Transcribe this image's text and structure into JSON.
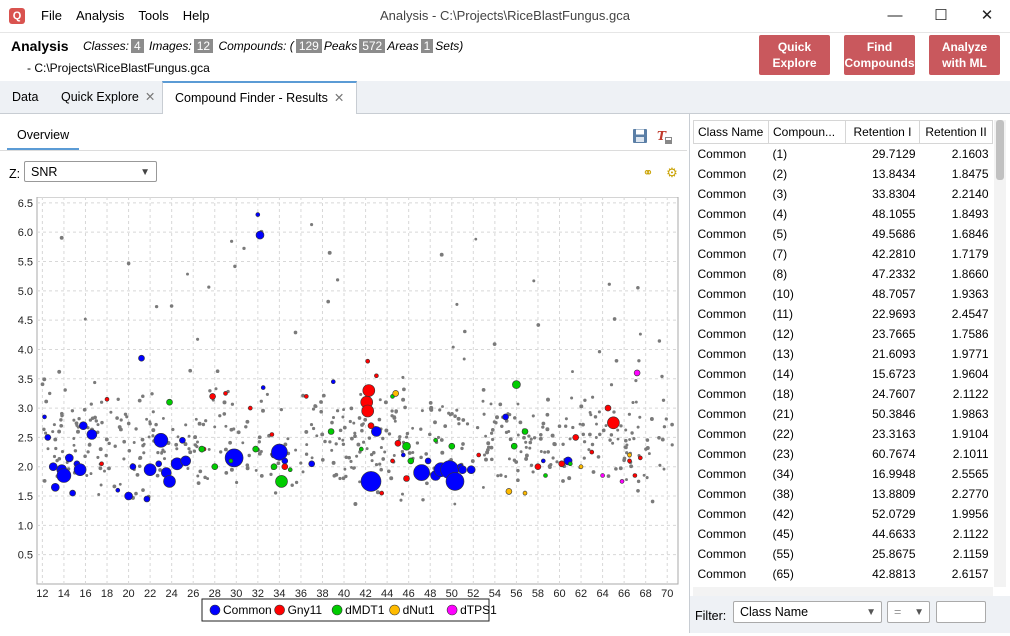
{
  "window": {
    "title": "Analysis - C:\\Projects\\RiceBlastFungus.gca",
    "app_icon": "magnifier-icon"
  },
  "menu": [
    "File",
    "Analysis",
    "Tools",
    "Help"
  ],
  "header": {
    "title": "Analysis",
    "classes_label": "Classes:",
    "classes": "4",
    "images_label": "Images:",
    "images": "12",
    "compounds_label": "Compounds: (",
    "compounds": "129",
    "peaks_label": "Peaks",
    "peaks": "572",
    "areas_label": "Areas",
    "areas": "1",
    "sets_label": "Sets)",
    "path": "- C:\\Projects\\RiceBlastFungus.gca",
    "buttons": {
      "quick_explore": "Quick Explore",
      "find_compounds": "Find Compounds",
      "analyze_ml": "Analyze with ML"
    }
  },
  "tabs": [
    {
      "label": "Data"
    },
    {
      "label": "Quick Explore",
      "closable": true
    },
    {
      "label": "Compound Finder - Results",
      "closable": true,
      "active": true
    }
  ],
  "subtab": "Overview",
  "z_selector": {
    "label": "Z:",
    "value": "SNR"
  },
  "chart_data": {
    "type": "scatter",
    "xlim": [
      11.5,
      71
    ],
    "ylim": [
      0,
      6.6
    ],
    "x_ticks": [
      12,
      14,
      16,
      18,
      20,
      22,
      24,
      26,
      28,
      30,
      32,
      34,
      36,
      38,
      40,
      42,
      44,
      46,
      48,
      50,
      52,
      54,
      56,
      58,
      60,
      62,
      64,
      66,
      68,
      70
    ],
    "y_ticks": [
      0.5,
      1.0,
      1.5,
      2.0,
      2.5,
      3.0,
      3.5,
      4.0,
      4.5,
      5.0,
      5.5,
      6.0,
      6.5
    ],
    "grid": true,
    "legend_position": "bottom",
    "legend": [
      {
        "name": "Common",
        "color": "#0000ff"
      },
      {
        "name": "Gny11",
        "color": "#ff0000"
      },
      {
        "name": "dMDT1",
        "color": "#00cc00"
      },
      {
        "name": "dNut1",
        "color": "#ffbb00"
      },
      {
        "name": "dTPS1",
        "color": "#ff00ff"
      }
    ],
    "series": [
      {
        "name": "Common",
        "color": "#0000ff",
        "points": [
          [
            12.2,
            2.85,
            2
          ],
          [
            12.5,
            2.5,
            3
          ],
          [
            13.0,
            2.0,
            4
          ],
          [
            13.2,
            1.65,
            4
          ],
          [
            13.8,
            1.95,
            5
          ],
          [
            14.0,
            1.85,
            7
          ],
          [
            14.5,
            2.15,
            4
          ],
          [
            14.8,
            1.55,
            3
          ],
          [
            15.2,
            2.05,
            3
          ],
          [
            15.5,
            1.95,
            6
          ],
          [
            15.8,
            2.7,
            4
          ],
          [
            16.6,
            2.55,
            5
          ],
          [
            19.0,
            1.6,
            2
          ],
          [
            20.0,
            1.5,
            4
          ],
          [
            20.4,
            2.0,
            3
          ],
          [
            21.2,
            3.85,
            3
          ],
          [
            21.7,
            1.45,
            3
          ],
          [
            22.0,
            1.95,
            6
          ],
          [
            22.8,
            2.05,
            3
          ],
          [
            23.0,
            2.45,
            7
          ],
          [
            23.5,
            1.9,
            5
          ],
          [
            23.8,
            1.75,
            6
          ],
          [
            24.5,
            2.05,
            6
          ],
          [
            25.0,
            2.45,
            3
          ],
          [
            25.3,
            2.1,
            5
          ],
          [
            29.8,
            2.15,
            9
          ],
          [
            32.0,
            6.3,
            2
          ],
          [
            32.2,
            5.95,
            4
          ],
          [
            32.5,
            3.35,
            2
          ],
          [
            33.5,
            2.2,
            3
          ],
          [
            34.0,
            2.25,
            8
          ],
          [
            34.5,
            2.1,
            3
          ],
          [
            37.0,
            2.05,
            3
          ],
          [
            39.0,
            3.45,
            2
          ],
          [
            42.5,
            1.75,
            10
          ],
          [
            43.0,
            2.6,
            5
          ],
          [
            45.5,
            2.2,
            2
          ],
          [
            47.2,
            1.9,
            8
          ],
          [
            47.8,
            2.1,
            3
          ],
          [
            48.5,
            1.85,
            5
          ],
          [
            49.0,
            1.95,
            7
          ],
          [
            49.8,
            1.95,
            9
          ],
          [
            50.3,
            1.75,
            9
          ],
          [
            50.8,
            2.0,
            3
          ],
          [
            51.0,
            1.95,
            4
          ],
          [
            51.8,
            1.95,
            4
          ],
          [
            55.0,
            2.85,
            3
          ],
          [
            58.5,
            2.1,
            2
          ],
          [
            60.8,
            2.1,
            4
          ]
        ]
      },
      {
        "name": "Gny11",
        "color": "#ff0000",
        "points": [
          [
            17.5,
            2.05,
            2
          ],
          [
            18.0,
            3.15,
            2
          ],
          [
            27.0,
            2.3,
            2
          ],
          [
            27.8,
            3.2,
            3
          ],
          [
            29.0,
            3.25,
            2
          ],
          [
            31.3,
            3.0,
            2
          ],
          [
            33.3,
            2.55,
            2
          ],
          [
            34.5,
            2.0,
            3
          ],
          [
            36.5,
            3.2,
            2
          ],
          [
            42.2,
            3.8,
            2
          ],
          [
            42.3,
            3.3,
            6
          ],
          [
            42.1,
            3.1,
            6
          ],
          [
            42.2,
            2.95,
            6
          ],
          [
            42.5,
            2.7,
            3
          ],
          [
            43.0,
            3.55,
            2
          ],
          [
            43.5,
            1.55,
            2
          ],
          [
            44.5,
            2.1,
            2
          ],
          [
            45.0,
            2.4,
            3
          ],
          [
            45.8,
            1.8,
            3
          ],
          [
            52.5,
            2.2,
            2
          ],
          [
            58.0,
            2.0,
            3
          ],
          [
            60.2,
            2.05,
            3
          ],
          [
            61.5,
            2.5,
            3
          ],
          [
            63.0,
            2.25,
            2
          ],
          [
            64.5,
            3.0,
            3
          ],
          [
            65.0,
            2.75,
            6
          ],
          [
            66.5,
            2.1,
            2
          ],
          [
            67.0,
            1.85,
            2
          ],
          [
            67.5,
            2.15,
            2
          ]
        ]
      },
      {
        "name": "dMDT1",
        "color": "#00cc00",
        "points": [
          [
            23.8,
            3.1,
            3
          ],
          [
            26.8,
            2.3,
            3
          ],
          [
            28.0,
            2.0,
            3
          ],
          [
            29.5,
            2.1,
            2
          ],
          [
            31.8,
            2.3,
            3
          ],
          [
            33.5,
            2.0,
            3
          ],
          [
            34.2,
            1.75,
            6
          ],
          [
            35.0,
            1.95,
            2
          ],
          [
            38.8,
            2.6,
            3
          ],
          [
            41.6,
            2.3,
            2
          ],
          [
            44.5,
            3.2,
            2
          ],
          [
            45.8,
            2.35,
            4
          ],
          [
            46.2,
            2.1,
            3
          ],
          [
            48.5,
            2.45,
            2
          ],
          [
            50.0,
            2.35,
            3
          ],
          [
            55.8,
            2.35,
            3
          ],
          [
            56.0,
            3.4,
            4
          ],
          [
            56.8,
            2.6,
            3
          ],
          [
            58.7,
            1.85,
            2
          ],
          [
            61.0,
            2.05,
            2
          ]
        ]
      },
      {
        "name": "dNut1",
        "color": "#ffbb00",
        "points": [
          [
            44.8,
            3.25,
            3
          ],
          [
            55.3,
            1.58,
            3
          ],
          [
            56.8,
            1.55,
            2
          ],
          [
            62.0,
            2.0,
            2
          ],
          [
            66.5,
            2.2,
            2
          ]
        ]
      },
      {
        "name": "dTPS1",
        "color": "#ff00ff",
        "points": [
          [
            67.2,
            3.6,
            3
          ],
          [
            64.0,
            1.85,
            2
          ],
          [
            65.8,
            1.75,
            2
          ]
        ]
      }
    ],
    "background_points_color": "#7a7a7a"
  },
  "table": {
    "columns": [
      "Class Name",
      "Compoun...",
      "Retention I",
      "Retention II"
    ],
    "rows": [
      [
        "Common",
        "(1)",
        "29.7129",
        "2.1603"
      ],
      [
        "Common",
        "(2)",
        "13.8434",
        "1.8475"
      ],
      [
        "Common",
        "(3)",
        "33.8304",
        "2.2140"
      ],
      [
        "Common",
        "(4)",
        "48.1055",
        "1.8493"
      ],
      [
        "Common",
        "(5)",
        "49.5686",
        "1.6846"
      ],
      [
        "Common",
        "(7)",
        "42.2810",
        "1.7179"
      ],
      [
        "Common",
        "(8)",
        "47.2332",
        "1.8660"
      ],
      [
        "Common",
        "(10)",
        "48.7057",
        "1.9363"
      ],
      [
        "Common",
        "(11)",
        "22.9693",
        "2.4547"
      ],
      [
        "Common",
        "(12)",
        "23.7665",
        "1.7586"
      ],
      [
        "Common",
        "(13)",
        "21.6093",
        "1.9771"
      ],
      [
        "Common",
        "(14)",
        "15.6723",
        "1.9604"
      ],
      [
        "Common",
        "(18)",
        "24.7607",
        "2.1122"
      ],
      [
        "Common",
        "(21)",
        "50.3846",
        "1.9863"
      ],
      [
        "Common",
        "(22)",
        "23.3163",
        "1.9104"
      ],
      [
        "Common",
        "(23)",
        "60.7674",
        "2.1011"
      ],
      [
        "Common",
        "(34)",
        "16.9948",
        "2.5565"
      ],
      [
        "Common",
        "(38)",
        "13.8809",
        "2.2770"
      ],
      [
        "Common",
        "(42)",
        "52.0729",
        "1.9956"
      ],
      [
        "Common",
        "(45)",
        "44.6633",
        "2.1122"
      ],
      [
        "Common",
        "(55)",
        "25.8675",
        "2.1159"
      ],
      [
        "Common",
        "(65)",
        "42.8813",
        "2.6157"
      ]
    ]
  },
  "filter": {
    "label": "Filter:",
    "field": "Class Name",
    "op": "=",
    "value": ""
  }
}
